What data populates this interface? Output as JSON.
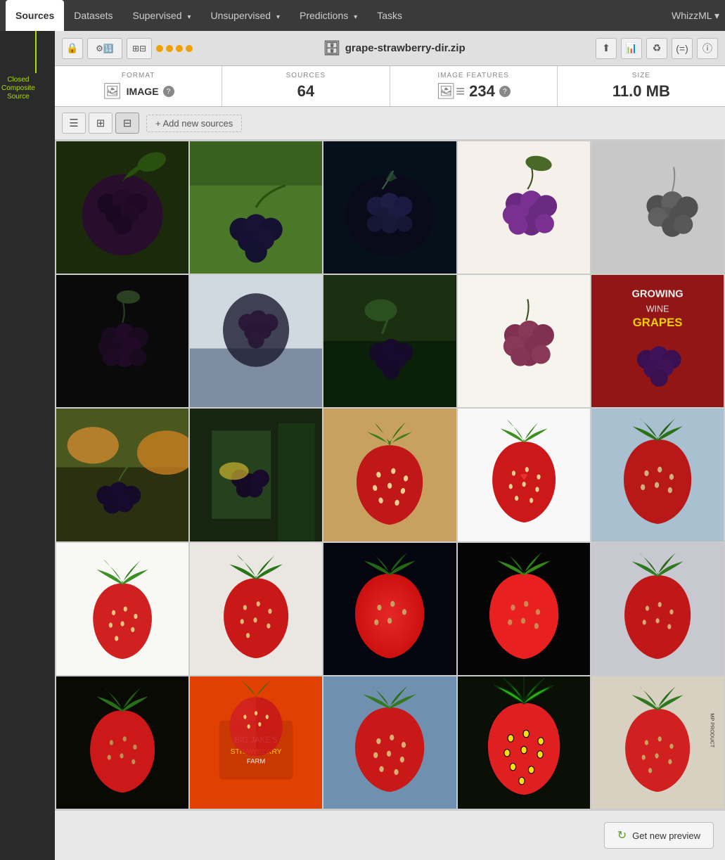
{
  "nav": {
    "items": [
      {
        "label": "Sources",
        "active": true,
        "hasArrow": false
      },
      {
        "label": "Datasets",
        "active": false,
        "hasArrow": false
      },
      {
        "label": "Supervised",
        "active": false,
        "hasArrow": true
      },
      {
        "label": "Unsupervised",
        "active": false,
        "hasArrow": true
      },
      {
        "label": "Predictions",
        "active": false,
        "hasArrow": true
      },
      {
        "label": "Tasks",
        "active": false,
        "hasArrow": false
      }
    ],
    "brand": "WhizzML"
  },
  "sidebar": {
    "label": "Closed\nComposite\nSource"
  },
  "toolbar": {
    "filename": "grape-strawberry-dir.zip",
    "lock_icon": "🔒",
    "dots": [
      "#f0a000",
      "#f0a000",
      "#f0a000",
      "#f0a000"
    ]
  },
  "stats": {
    "format": {
      "label": "FORMAT",
      "icon": "🖼",
      "value": "IMAGE",
      "has_info": true
    },
    "sources": {
      "label": "SOURCES",
      "value": "64"
    },
    "image_features": {
      "label": "IMAGE FEATURES",
      "value": "234",
      "has_info": true
    },
    "size": {
      "label": "SIZE",
      "value": "11.0 MB"
    }
  },
  "view_controls": {
    "add_label": "+ Add new sources"
  },
  "footer": {
    "preview_btn": "Get new preview"
  },
  "images": [
    {
      "id": 1,
      "bg": "#1a2a0a",
      "type": "grape_dark_leaf"
    },
    {
      "id": 2,
      "bg": "#0a1a05",
      "type": "grape_outdoor"
    },
    {
      "id": 3,
      "bg": "#05101a",
      "type": "grape_blue"
    },
    {
      "id": 4,
      "bg": "#150a20",
      "type": "grape_purple"
    },
    {
      "id": 5,
      "bg": "#b0b0b0",
      "type": "grape_bw"
    },
    {
      "id": 6,
      "bg": "#0a0a0a",
      "type": "grape_dark"
    },
    {
      "id": 7,
      "bg": "#d0d8e0",
      "type": "grape_car"
    },
    {
      "id": 8,
      "bg": "#0a1505",
      "type": "grape_vine"
    },
    {
      "id": 9,
      "bg": "#2a1030",
      "type": "grape_bunch"
    },
    {
      "id": 10,
      "bg": "#8a1010",
      "type": "grape_book"
    },
    {
      "id": 11,
      "bg": "#2a3010",
      "type": "grape_autumn"
    },
    {
      "id": 12,
      "bg": "#0a1005",
      "type": "grape_market"
    },
    {
      "id": 13,
      "bg": "#c8a060",
      "type": "strawberry_single"
    },
    {
      "id": 14,
      "bg": "#f0f0f0",
      "type": "strawberry_white"
    },
    {
      "id": 15,
      "bg": "#a0b8c8",
      "type": "strawberry_blue"
    },
    {
      "id": 16,
      "bg": "#f8f8f8",
      "type": "strawberry_sm1"
    },
    {
      "id": 17,
      "bg": "#e8e8e8",
      "type": "strawberry_sm2"
    },
    {
      "id": 18,
      "bg": "#050510",
      "type": "strawberry_dark"
    },
    {
      "id": 19,
      "bg": "#050505",
      "type": "strawberry_black"
    },
    {
      "id": 20,
      "bg": "#c0c0c8",
      "type": "strawberry_gray"
    },
    {
      "id": 21,
      "bg": "#0a0a05",
      "type": "strawberry_dark2"
    },
    {
      "id": 22,
      "bg": "#e04000",
      "type": "strawberry_orange"
    },
    {
      "id": 23,
      "bg": "#6090b0",
      "type": "strawberry_lightblue"
    },
    {
      "id": 24,
      "bg": "#0a1005",
      "type": "strawberry_illustrated"
    },
    {
      "id": 25,
      "bg": "#d8d0c0",
      "type": "strawberry_real"
    }
  ]
}
